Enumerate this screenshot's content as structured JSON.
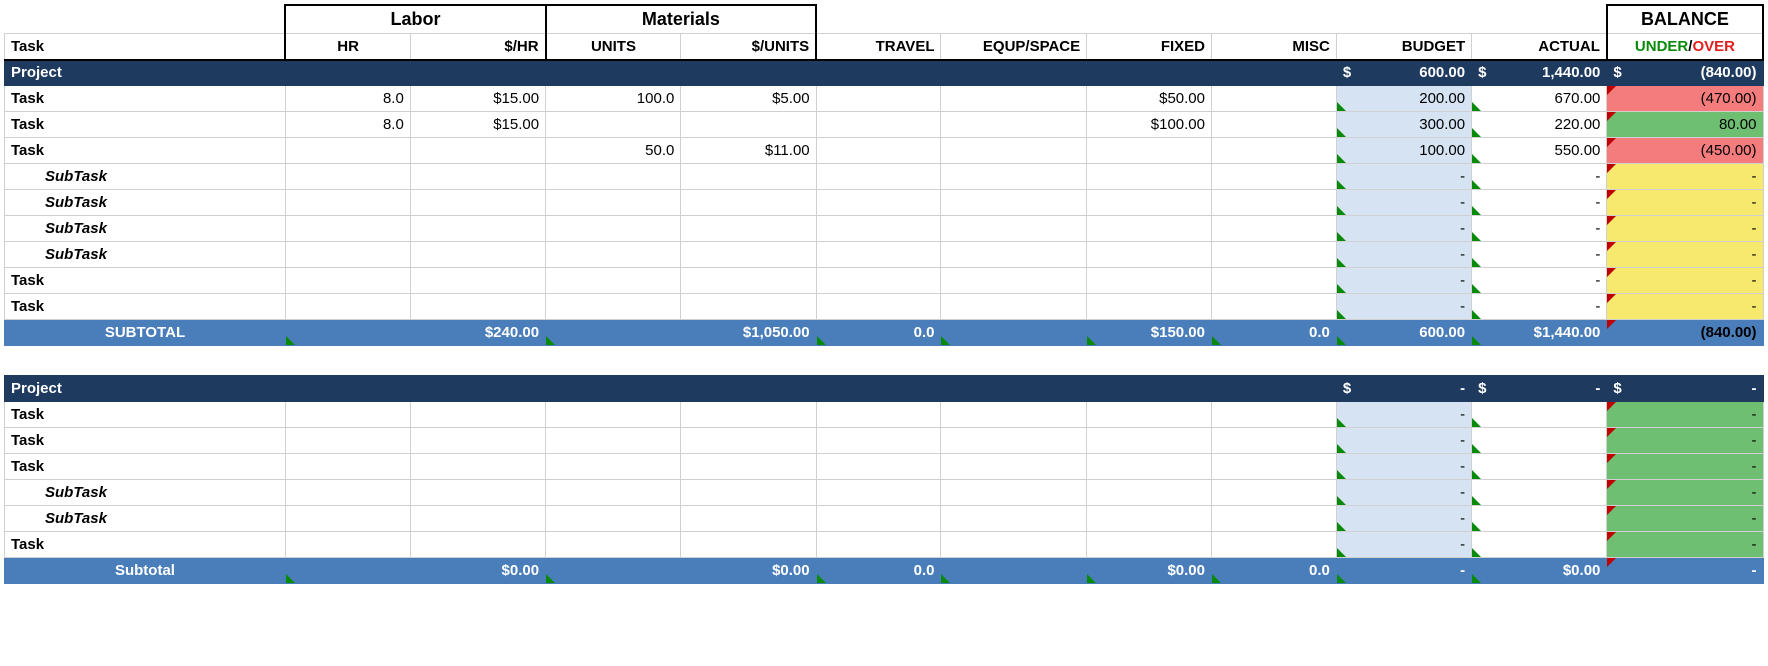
{
  "headers": {
    "task": "Task",
    "labor_group": "Labor",
    "labor_hr": "HR",
    "labor_rate": "$/HR",
    "materials_group": "Materials",
    "materials_units": "UNITS",
    "materials_rate": "$/UNITS",
    "travel": "TRAVEL",
    "equip": "EQUP/SPACE",
    "fixed": "FIXED",
    "misc": "MISC",
    "budget": "BUDGET",
    "actual": "ACTUAL",
    "balance": "BALANCE",
    "under": "UNDER",
    "slash": "/",
    "over": "OVER"
  },
  "section1": {
    "project_label": "Project",
    "project_budget_sym": "$",
    "project_budget_val": "600.00",
    "project_actual_sym": "$",
    "project_actual_val": "1,440.00",
    "project_balance_sym": "$",
    "project_balance_val": "(840.00)",
    "rows": [
      {
        "label": "Task",
        "type": "task",
        "hr": "8.0",
        "rate": "$15.00",
        "units": "100.0",
        "urate": "$5.00",
        "travel": "",
        "equip": "",
        "fixed": "$50.00",
        "misc": "",
        "budget": "200.00",
        "actual": "670.00",
        "balance": "(470.00)",
        "bal_color": "red"
      },
      {
        "label": "Task",
        "type": "task",
        "hr": "8.0",
        "rate": "$15.00",
        "units": "",
        "urate": "",
        "travel": "",
        "equip": "",
        "fixed": "$100.00",
        "misc": "",
        "budget": "300.00",
        "actual": "220.00",
        "balance": "80.00",
        "bal_color": "green"
      },
      {
        "label": "Task",
        "type": "task",
        "hr": "",
        "rate": "",
        "units": "50.0",
        "urate": "$11.00",
        "travel": "",
        "equip": "",
        "fixed": "",
        "misc": "",
        "budget": "100.00",
        "actual": "550.00",
        "balance": "(450.00)",
        "bal_color": "red"
      },
      {
        "label": "SubTask",
        "type": "subtask",
        "hr": "",
        "rate": "",
        "units": "",
        "urate": "",
        "travel": "",
        "equip": "",
        "fixed": "",
        "misc": "",
        "budget": "-",
        "actual": "-",
        "balance": "-",
        "bal_color": "yellow"
      },
      {
        "label": "SubTask",
        "type": "subtask",
        "hr": "",
        "rate": "",
        "units": "",
        "urate": "",
        "travel": "",
        "equip": "",
        "fixed": "",
        "misc": "",
        "budget": "-",
        "actual": "-",
        "balance": "-",
        "bal_color": "yellow"
      },
      {
        "label": "SubTask",
        "type": "subtask",
        "hr": "",
        "rate": "",
        "units": "",
        "urate": "",
        "travel": "",
        "equip": "",
        "fixed": "",
        "misc": "",
        "budget": "-",
        "actual": "-",
        "balance": "-",
        "bal_color": "yellow"
      },
      {
        "label": "SubTask",
        "type": "subtask",
        "hr": "",
        "rate": "",
        "units": "",
        "urate": "",
        "travel": "",
        "equip": "",
        "fixed": "",
        "misc": "",
        "budget": "-",
        "actual": "-",
        "balance": "-",
        "bal_color": "yellow"
      },
      {
        "label": "Task",
        "type": "task",
        "hr": "",
        "rate": "",
        "units": "",
        "urate": "",
        "travel": "",
        "equip": "",
        "fixed": "",
        "misc": "",
        "budget": "-",
        "actual": "-",
        "balance": "-",
        "bal_color": "yellow"
      },
      {
        "label": "Task",
        "type": "task",
        "hr": "",
        "rate": "",
        "units": "",
        "urate": "",
        "travel": "",
        "equip": "",
        "fixed": "",
        "misc": "",
        "budget": "-",
        "actual": "-",
        "balance": "-",
        "bal_color": "yellow"
      }
    ],
    "subtotal_label": "SUBTOTAL",
    "subtotal": {
      "labor": "$240.00",
      "materials": "$1,050.00",
      "travel": "0.0",
      "equip": "",
      "fixed": "$150.00",
      "misc": "0.0",
      "budget": "600.00",
      "actual": "$1,440.00",
      "balance": "(840.00)"
    }
  },
  "section2": {
    "project_label": "Project",
    "project_budget_sym": "$",
    "project_budget_val": "-",
    "project_actual_sym": "$",
    "project_actual_val": "-",
    "project_balance_sym": "$",
    "project_balance_val": "-",
    "rows": [
      {
        "label": "Task",
        "type": "task",
        "hr": "",
        "rate": "",
        "units": "",
        "urate": "",
        "travel": "",
        "equip": "",
        "fixed": "",
        "misc": "",
        "budget": "-",
        "actual": "",
        "balance": "-",
        "bal_color": "green"
      },
      {
        "label": "Task",
        "type": "task",
        "hr": "",
        "rate": "",
        "units": "",
        "urate": "",
        "travel": "",
        "equip": "",
        "fixed": "",
        "misc": "",
        "budget": "-",
        "actual": "",
        "balance": "-",
        "bal_color": "green"
      },
      {
        "label": "Task",
        "type": "task",
        "hr": "",
        "rate": "",
        "units": "",
        "urate": "",
        "travel": "",
        "equip": "",
        "fixed": "",
        "misc": "",
        "budget": "-",
        "actual": "",
        "balance": "-",
        "bal_color": "green"
      },
      {
        "label": "SubTask",
        "type": "subtask",
        "hr": "",
        "rate": "",
        "units": "",
        "urate": "",
        "travel": "",
        "equip": "",
        "fixed": "",
        "misc": "",
        "budget": "-",
        "actual": "",
        "balance": "-",
        "bal_color": "green"
      },
      {
        "label": "SubTask",
        "type": "subtask",
        "hr": "",
        "rate": "",
        "units": "",
        "urate": "",
        "travel": "",
        "equip": "",
        "fixed": "",
        "misc": "",
        "budget": "-",
        "actual": "",
        "balance": "-",
        "bal_color": "green"
      },
      {
        "label": "Task",
        "type": "task",
        "hr": "",
        "rate": "",
        "units": "",
        "urate": "",
        "travel": "",
        "equip": "",
        "fixed": "",
        "misc": "",
        "budget": "-",
        "actual": "",
        "balance": "-",
        "bal_color": "green"
      }
    ],
    "subtotal_label": "Subtotal",
    "subtotal": {
      "labor": "$0.00",
      "materials": "$0.00",
      "travel": "0.0",
      "equip": "",
      "fixed": "$0.00",
      "misc": "0.0",
      "budget": "-",
      "actual": "$0.00",
      "balance": "-"
    }
  }
}
